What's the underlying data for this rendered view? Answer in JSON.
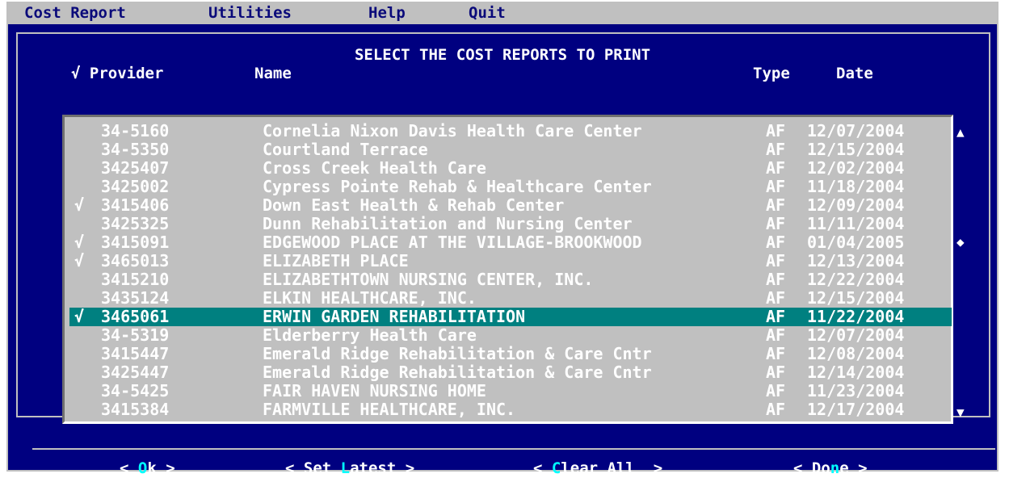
{
  "menu": {
    "items": [
      {
        "label": "Cost Report"
      },
      {
        "label": "Utilities"
      },
      {
        "label": "Help"
      },
      {
        "label": "Quit"
      }
    ]
  },
  "dialog": {
    "title": "SELECT THE COST REPORTS TO PRINT",
    "columns": {
      "check_provider": "√ Provider",
      "name": "Name",
      "type": "Type",
      "date": "Date"
    }
  },
  "list": {
    "rows": [
      {
        "checked": "",
        "provider": "34-5160",
        "name": "Cornelia Nixon Davis Health Care Center",
        "type": "AF",
        "date": "12/07/2004",
        "selected": false
      },
      {
        "checked": "",
        "provider": "34-5350",
        "name": "Courtland Terrace",
        "type": "AF",
        "date": "12/15/2004",
        "selected": false
      },
      {
        "checked": "",
        "provider": "3425407",
        "name": "Cross Creek Health Care",
        "type": "AF",
        "date": "12/02/2004",
        "selected": false
      },
      {
        "checked": "",
        "provider": "3425002",
        "name": "Cypress Pointe Rehab & Healthcare Center",
        "type": "AF",
        "date": "11/18/2004",
        "selected": false
      },
      {
        "checked": "√",
        "provider": "3415406",
        "name": "Down East Health & Rehab Center",
        "type": "AF",
        "date": "12/09/2004",
        "selected": false
      },
      {
        "checked": "",
        "provider": "3425325",
        "name": "Dunn Rehabilitation and Nursing Center",
        "type": "AF",
        "date": "11/11/2004",
        "selected": false
      },
      {
        "checked": "√",
        "provider": "3415091",
        "name": "EDGEWOOD PLACE AT THE VILLAGE-BROOKWOOD",
        "type": "AF",
        "date": "01/04/2005",
        "selected": false
      },
      {
        "checked": "√",
        "provider": "3465013",
        "name": "ELIZABETH PLACE",
        "type": "AF",
        "date": "12/13/2004",
        "selected": false
      },
      {
        "checked": "",
        "provider": "3415210",
        "name": "ELIZABETHTOWN NURSING CENTER, INC.",
        "type": "AF",
        "date": "12/22/2004",
        "selected": false
      },
      {
        "checked": "",
        "provider": "3435124",
        "name": "ELKIN HEALTHCARE, INC.",
        "type": "AF",
        "date": "12/15/2004",
        "selected": false
      },
      {
        "checked": "√",
        "provider": "3465061",
        "name": "ERWIN GARDEN REHABILITATION",
        "type": "AF",
        "date": "11/22/2004",
        "selected": true
      },
      {
        "checked": "",
        "provider": "34-5319",
        "name": "Elderberry Health Care",
        "type": "AF",
        "date": "12/07/2004",
        "selected": false
      },
      {
        "checked": "",
        "provider": "3415447",
        "name": "Emerald Ridge Rehabilitation & Care Cntr",
        "type": "AF",
        "date": "12/08/2004",
        "selected": false
      },
      {
        "checked": "",
        "provider": "3425447",
        "name": "Emerald Ridge Rehabilitation & Care Cntr",
        "type": "AF",
        "date": "12/14/2004",
        "selected": false
      },
      {
        "checked": "",
        "provider": "34-5425",
        "name": "FAIR HAVEN NURSING HOME",
        "type": "AF",
        "date": "11/23/2004",
        "selected": false
      },
      {
        "checked": "",
        "provider": "3415384",
        "name": "FARMVILLE HEALTHCARE, INC.",
        "type": "AF",
        "date": "12/17/2004",
        "selected": false
      }
    ]
  },
  "scrollbar": {
    "up_glyph": "▲",
    "thumb_glyph": "◆",
    "down_glyph": "▼"
  },
  "buttons": {
    "ok": {
      "pre": "< ",
      "hot": "O",
      "post": "k >"
    },
    "set_latest": {
      "pre": "< Set ",
      "hot": "L",
      "post": "atest >"
    },
    "clear_all": {
      "pre": "< ",
      "hot": "C",
      "post": "lear All  >"
    },
    "done": {
      "pre": "< Do",
      "hot": "n",
      "post": "e >"
    }
  },
  "colors": {
    "menubar_bg": "#c0c0c0",
    "window_bg": "#000080",
    "list_bg": "#c0c0c0",
    "selected_row": "#008080",
    "hotkey": "#00ffff"
  }
}
